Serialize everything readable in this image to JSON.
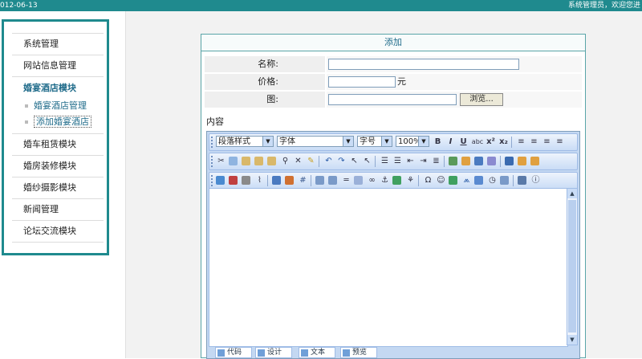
{
  "topbar": {
    "date": "012-06-13",
    "welcome": "系统管理员，欢迎您进"
  },
  "sidebar": {
    "items_top": [
      {
        "label": "系统管理"
      },
      {
        "label": "网站信息管理"
      }
    ],
    "group": {
      "title": "婚宴酒店模块",
      "subs": [
        {
          "label": "婚宴酒店管理"
        },
        {
          "label": "添加婚宴酒店"
        }
      ]
    },
    "items_bottom": [
      {
        "label": "婚车租赁模块"
      },
      {
        "label": "婚房装修模块"
      },
      {
        "label": "婚纱摄影模块"
      },
      {
        "label": "新闻管理"
      },
      {
        "label": "论坛交流模块"
      }
    ]
  },
  "form": {
    "title": "添加",
    "name_label": "名称:",
    "name_value": "",
    "price_label": "价格:",
    "price_value": "",
    "price_unit": "元",
    "image_label": "图:",
    "image_value": "",
    "browse_label": "浏览...",
    "content_label": "内容"
  },
  "editor": {
    "paragraph_style": "段落样式",
    "font": "字体",
    "font_size": "字号",
    "zoom": "100%",
    "modes": [
      {
        "label": "代码"
      },
      {
        "label": "设计"
      },
      {
        "label": "文本"
      },
      {
        "label": "预览"
      }
    ]
  }
}
